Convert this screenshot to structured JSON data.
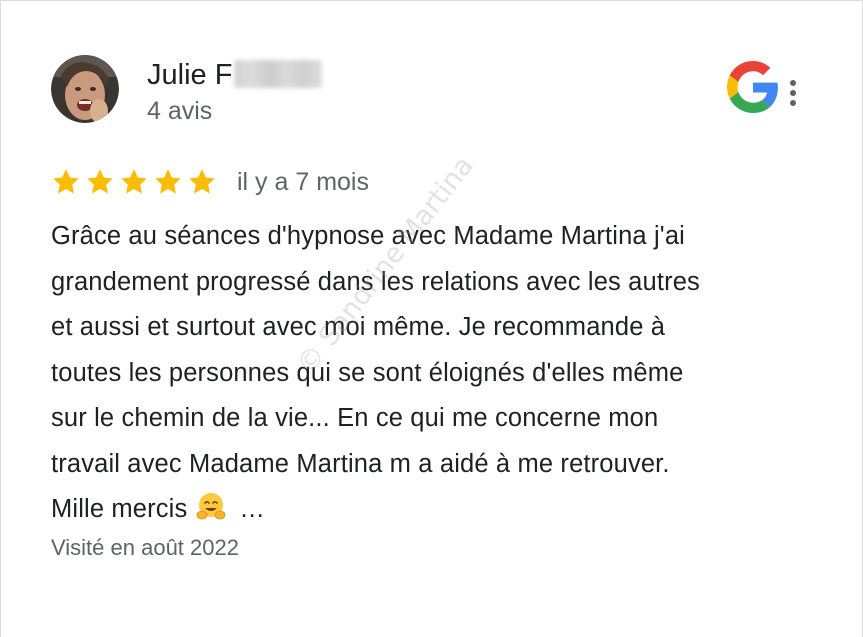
{
  "reviewer": {
    "name": "Julie F",
    "review_count": "4 avis"
  },
  "rating": {
    "stars": 5,
    "max_stars": 5,
    "date": "il y a 7 mois",
    "star_color": "#FBBC04"
  },
  "review": {
    "lines": [
      "Grâce au séances d'hypnose avec Madame Martina j'ai",
      "grandement progressé dans les relations avec les autres",
      "et aussi et surtout avec moi même. Je recommande à",
      "toutes les personnes qui se sont éloignés d'elles même",
      "sur le chemin de la vie... En ce qui me concerne mon",
      "travail avec Madame Martina m a aidé à me retrouver.",
      "Mille mercis"
    ],
    "emoji_icon": "hugging-face-emoji",
    "more_label": "…"
  },
  "visited": "Visité en août 2022",
  "watermark": "© Sandrine Martina",
  "icons": {
    "google": "google-logo-icon",
    "more": "more-vertical-icon"
  }
}
